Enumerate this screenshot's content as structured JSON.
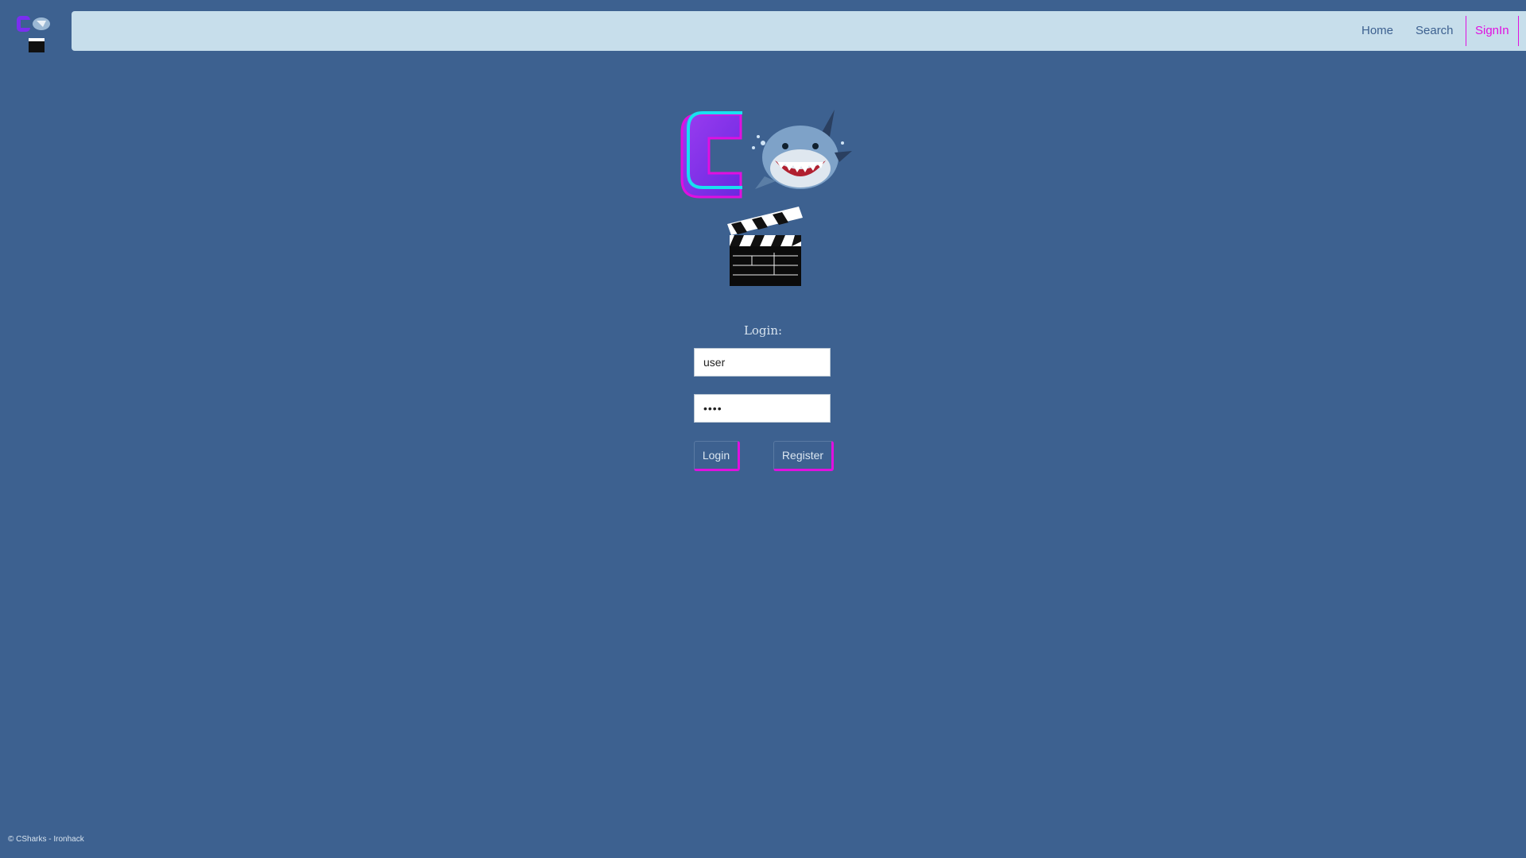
{
  "nav": {
    "home_label": "Home",
    "search_label": "Search",
    "signin_label": "SignIn"
  },
  "login": {
    "title": "Login:",
    "username_value": "user",
    "password_value": "••••",
    "login_button": "Login",
    "register_button": "Register"
  },
  "footer": {
    "text": "© CSharks - Ironhack"
  },
  "colors": {
    "background": "#3d6190",
    "navbar": "#c7deeb",
    "accent": "#e010e0",
    "logo_purple": "#7a2ff0",
    "logo_cyan": "#18e0f0"
  },
  "icons": [
    "csharks-logo",
    "shark-icon",
    "clapperboard-icon"
  ]
}
